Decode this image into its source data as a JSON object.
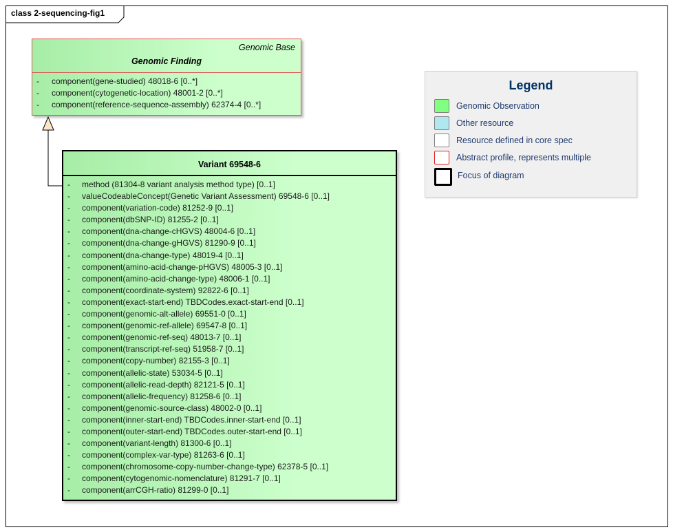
{
  "frame": {
    "label": "class 2-sequencing-fig1"
  },
  "genomic_finding": {
    "stereotype": "Genomic Base",
    "name": "Genomic Finding",
    "attributes": [
      {
        "dash": "-",
        "text": "component(gene-studied) 48018-6 [0..*]"
      },
      {
        "dash": "-",
        "text": "component(cytogenetic-location) 48001-2 [0..*]"
      },
      {
        "dash": "-",
        "text": "component(reference-sequence-assembly) 62374-4 [0..*]"
      }
    ]
  },
  "variant": {
    "name": "Variant 69548-6",
    "attributes": [
      {
        "dash": "-",
        "text": "method (81304-8 variant analysis method type) [0..1]"
      },
      {
        "dash": "-",
        "text": "valueCodeableConcept(Genetic Variant Assessment) 69548-6 [0..1]"
      },
      {
        "dash": "-",
        "text": "component(variation-code) 81252-9 [0..1]"
      },
      {
        "dash": "-",
        "text": "component(dbSNP-ID) 81255-2 [0..1]"
      },
      {
        "dash": "-",
        "text": "component(dna-change-cHGVS) 48004-6 [0..1]"
      },
      {
        "dash": "-",
        "text": "component(dna-change-gHGVS) 81290-9 [0..1]"
      },
      {
        "dash": "-",
        "text": "component(dna-change-type) 48019-4 [0..1]"
      },
      {
        "dash": "-",
        "text": "component(amino-acid-change-pHGVS) 48005-3 [0..1]"
      },
      {
        "dash": "-",
        "text": "component(amino-acid-change-type) 48006-1 [0..1]"
      },
      {
        "dash": "-",
        "text": "component(coordinate-system) 92822-6 [0..1]"
      },
      {
        "dash": "-",
        "text": "component(exact-start-end) TBDCodes.exact-start-end [0..1]"
      },
      {
        "dash": "-",
        "text": "component(genomic-alt-allele) 69551-0 [0..1]"
      },
      {
        "dash": "-",
        "text": "component(genomic-ref-allele) 69547-8 [0..1]"
      },
      {
        "dash": "-",
        "text": "component(genomic-ref-seq) 48013-7 [0..1]"
      },
      {
        "dash": "-",
        "text": "component(transcript-ref-seq) 51958-7 [0..1]"
      },
      {
        "dash": "-",
        "text": "component(copy-number) 82155-3 [0..1]"
      },
      {
        "dash": "-",
        "text": "component(allelic-state) 53034-5 [0..1]"
      },
      {
        "dash": "-",
        "text": "component(allelic-read-depth) 82121-5 [0..1]"
      },
      {
        "dash": "-",
        "text": "component(allelic-frequency) 81258-6 [0..1]"
      },
      {
        "dash": "-",
        "text": "component(genomic-source-class) 48002-0 [0..1]"
      },
      {
        "dash": "-",
        "text": "component(inner-start-end) TBDCodes.inner-start-end [0..1]"
      },
      {
        "dash": "-",
        "text": "component(outer-start-end) TBDCodes.outer-start-end [0..1]"
      },
      {
        "dash": "-",
        "text": "component(variant-length) 81300-6 [0..1]"
      },
      {
        "dash": "-",
        "text": "component(complex-var-type) 81263-6 [0..1]"
      },
      {
        "dash": "-",
        "text": "component(chromosome-copy-number-change-type) 62378-5 [0..1]"
      },
      {
        "dash": "-",
        "text": "component(cytogenomic-nomenclature) 81291-7 [0..1]"
      },
      {
        "dash": "-",
        "text": "component(arrCGH-ratio) 81299-0 [0..1]"
      }
    ]
  },
  "legend": {
    "title": "Legend",
    "items": [
      {
        "label": "Genomic Observation",
        "fill": "#80ff80",
        "border": "#808080"
      },
      {
        "label": "Other resource",
        "fill": "#b0e8f0",
        "border": "#808080"
      },
      {
        "label": "Resource defined in core spec",
        "fill": "#ffffff",
        "border": "#808080"
      },
      {
        "label": "Abstract profile, represents multiple",
        "fill": "#ffffff",
        "border": "#e02020"
      },
      {
        "label": "Focus of diagram",
        "fill": "#ffffff",
        "border": "#000000"
      }
    ]
  }
}
